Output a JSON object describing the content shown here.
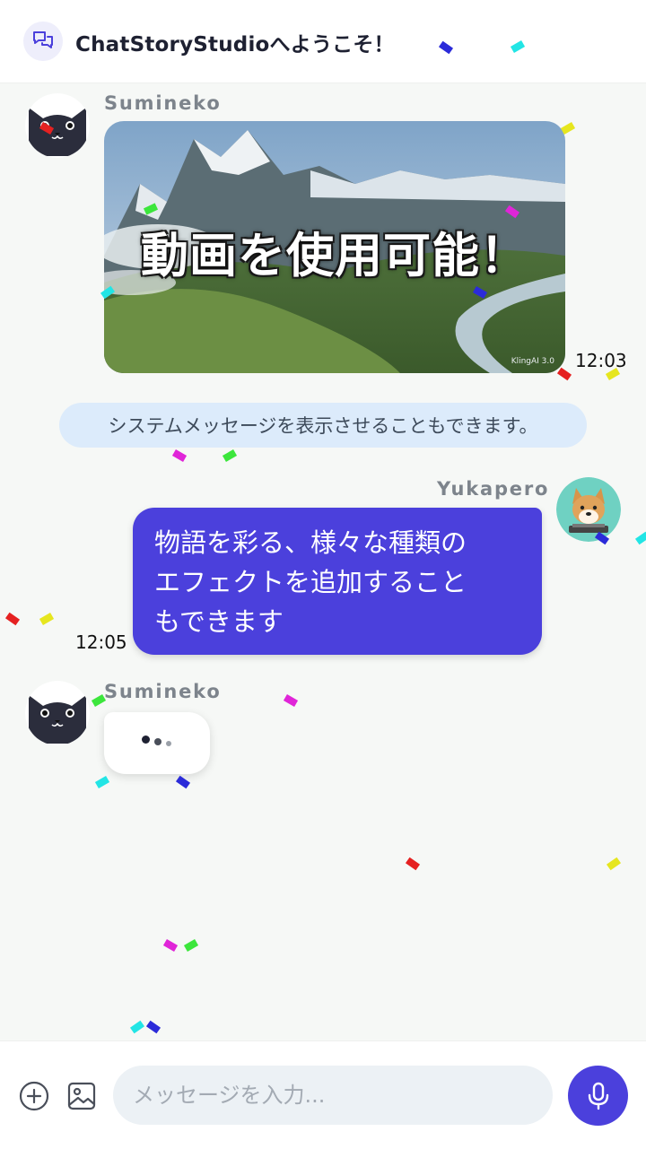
{
  "header": {
    "title": "ChatStoryStudioへようこそ！"
  },
  "messages": [
    {
      "sender": "Sumineko",
      "video_title": "動画を使用可能！",
      "watermark": "KlingAI 3.0",
      "time": "12:03"
    },
    {
      "system": "システムメッセージを表示させることもできます。"
    },
    {
      "sender": "Yukapero",
      "lines": [
        "物語を彩る、様々な種類の",
        "エフェクトを追加すること",
        "もできます"
      ],
      "time": "12:05"
    },
    {
      "sender": "Sumineko",
      "typing": true
    }
  ],
  "composer": {
    "placeholder": "メッセージを入力..."
  },
  "colors": {
    "accent": "#4b40dc",
    "system_bg": "#dcebfb",
    "background": "#f6f8f6"
  },
  "icons": [
    "chat-bubbles-icon",
    "cat-avatar",
    "shiba-avatar",
    "add-circle-icon",
    "image-icon",
    "mic-icon"
  ]
}
